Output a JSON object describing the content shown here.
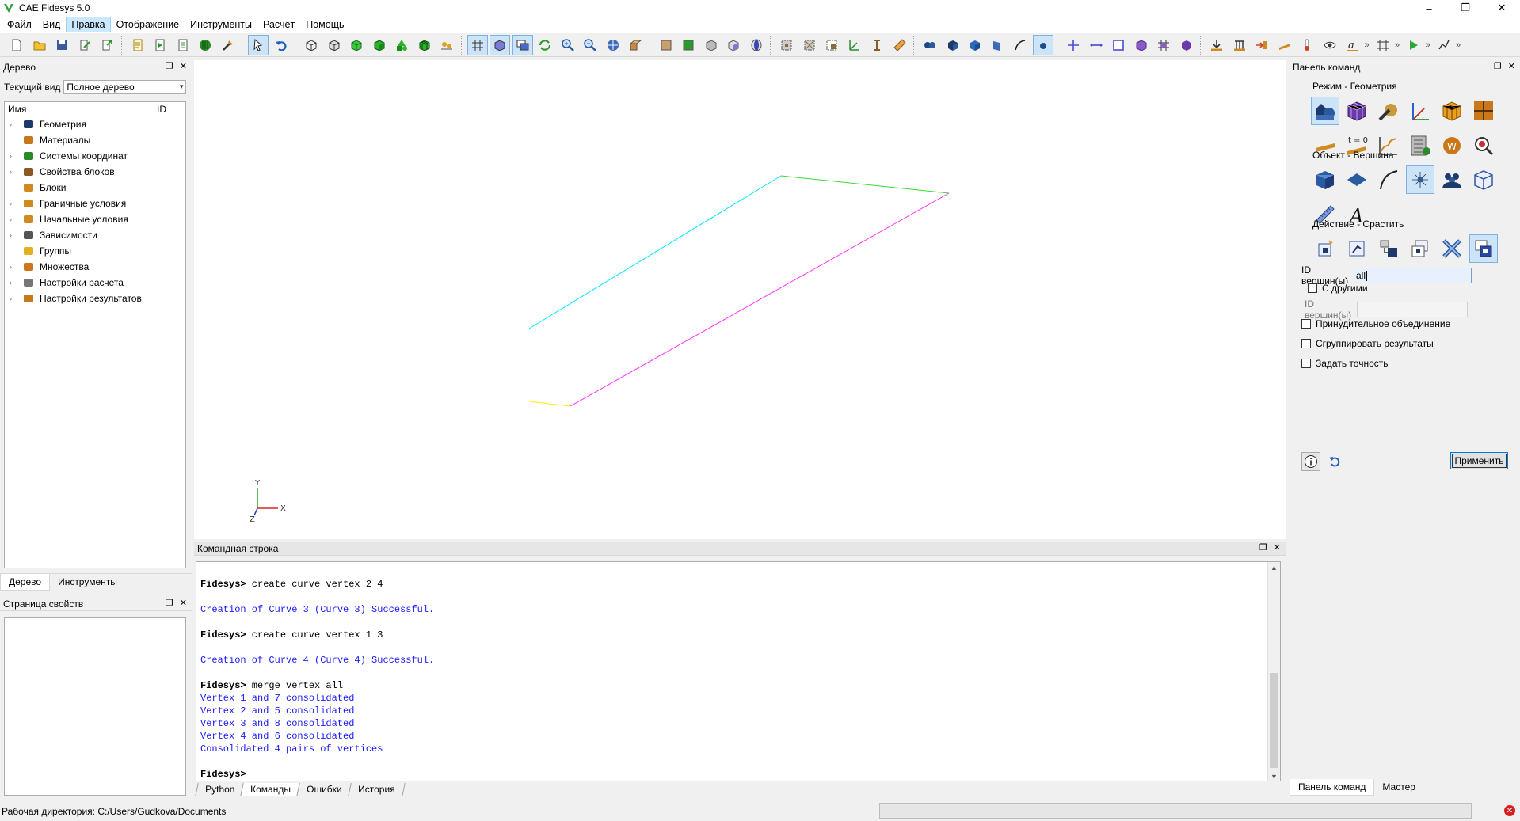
{
  "window": {
    "title": "CAE Fidesys 5.0",
    "minimize": "–",
    "restore": "❐",
    "close": "✕"
  },
  "menu": [
    "Файл",
    "Вид",
    "Правка",
    "Отображение",
    "Инструменты",
    "Расчёт",
    "Помощь"
  ],
  "colors": {
    "accent": "#cce8ff",
    "output_text": "#1a1aff",
    "curve_cyan": "#00e5ff",
    "curve_green": "#33dd33",
    "curve_magenta": "#ff33ff",
    "curve_yellow": "#ffee00"
  },
  "toolbar_more": "»",
  "tree_panel": {
    "title": "Дерево",
    "view_label": "Текущий вид",
    "view_value": "Полное дерево",
    "col_name": "Имя",
    "col_id": "ID",
    "items": [
      {
        "label": "Геометрия",
        "icon": "geometry-icon",
        "expandable": true
      },
      {
        "label": "Материалы",
        "icon": "materials-icon",
        "expandable": false
      },
      {
        "label": "Системы координат",
        "icon": "coordinate-systems-icon",
        "expandable": true
      },
      {
        "label": "Свойства блоков",
        "icon": "block-properties-icon",
        "expandable": true
      },
      {
        "label": "Блоки",
        "icon": "blocks-icon",
        "expandable": false
      },
      {
        "label": "Граничные условия",
        "icon": "boundary-conditions-icon",
        "expandable": true
      },
      {
        "label": "Начальные условия",
        "icon": "initial-conditions-icon",
        "expandable": true
      },
      {
        "label": "Зависимости",
        "icon": "dependencies-icon",
        "expandable": true
      },
      {
        "label": "Группы",
        "icon": "groups-icon",
        "expandable": false
      },
      {
        "label": "Множества",
        "icon": "sets-icon",
        "expandable": true
      },
      {
        "label": "Настройки расчета",
        "icon": "analysis-settings-icon",
        "expandable": true
      },
      {
        "label": "Настройки результатов",
        "icon": "results-settings-icon",
        "expandable": true
      }
    ]
  },
  "left_tabs": [
    "Дерево",
    "Инструменты"
  ],
  "props_panel": {
    "title": "Страница свойств"
  },
  "axes": {
    "x": "X",
    "y": "Y",
    "z": "Z"
  },
  "cmd_panel": {
    "title": "Командная строка",
    "lines": [
      {
        "kind": "blank",
        "prompt": "",
        "text": ""
      },
      {
        "kind": "prompt",
        "prompt": "Fidesys>",
        "text": " create curve vertex 2 4"
      },
      {
        "kind": "blank",
        "prompt": "",
        "text": ""
      },
      {
        "kind": "out",
        "prompt": "",
        "text": "Creation of Curve 3 (Curve 3) Successful."
      },
      {
        "kind": "blank",
        "prompt": "",
        "text": ""
      },
      {
        "kind": "prompt",
        "prompt": "Fidesys>",
        "text": " create curve vertex 1 3"
      },
      {
        "kind": "blank",
        "prompt": "",
        "text": ""
      },
      {
        "kind": "out",
        "prompt": "",
        "text": "Creation of Curve 4 (Curve 4) Successful."
      },
      {
        "kind": "blank",
        "prompt": "",
        "text": ""
      },
      {
        "kind": "prompt",
        "prompt": "Fidesys>",
        "text": " merge vertex all"
      },
      {
        "kind": "out",
        "prompt": "",
        "text": "Vertex 1 and 7 consolidated"
      },
      {
        "kind": "out",
        "prompt": "",
        "text": "Vertex 2 and 5 consolidated"
      },
      {
        "kind": "out",
        "prompt": "",
        "text": "Vertex 3 and 8 consolidated"
      },
      {
        "kind": "out",
        "prompt": "",
        "text": "Vertex 4 and 6 consolidated"
      },
      {
        "kind": "out",
        "prompt": "",
        "text": "Consolidated 4 pairs of vertices"
      },
      {
        "kind": "blank",
        "prompt": "",
        "text": ""
      },
      {
        "kind": "prompt",
        "prompt": "Fidesys>",
        "text": ""
      }
    ],
    "tabs": [
      "Python",
      "Команды",
      "Ошибки",
      "История"
    ],
    "active_tab": 1
  },
  "right_panel": {
    "title": "Панель команд",
    "mode_section": "Режим - Геометрия",
    "object_section": "Объект - Вершина",
    "action_section": "Действие - Срастить",
    "vertex_id_label": "ID вершин(ы)",
    "vertex_id_value": "all",
    "with_others_label": "С другими",
    "with_others_id_label": "ID вершин(ы)",
    "force_merge_label": "Принудительное объединение",
    "group_results_label": "Сгруппировать результаты",
    "set_tolerance_label": "Задать точность",
    "t0_label": "t = 0",
    "apply_label": "Применить",
    "tabs": [
      "Панель команд",
      "Мастер"
    ]
  },
  "status": {
    "text": "Рабочая директория: C:/Users/Gudkova/Documents",
    "error_badge": "✕"
  }
}
